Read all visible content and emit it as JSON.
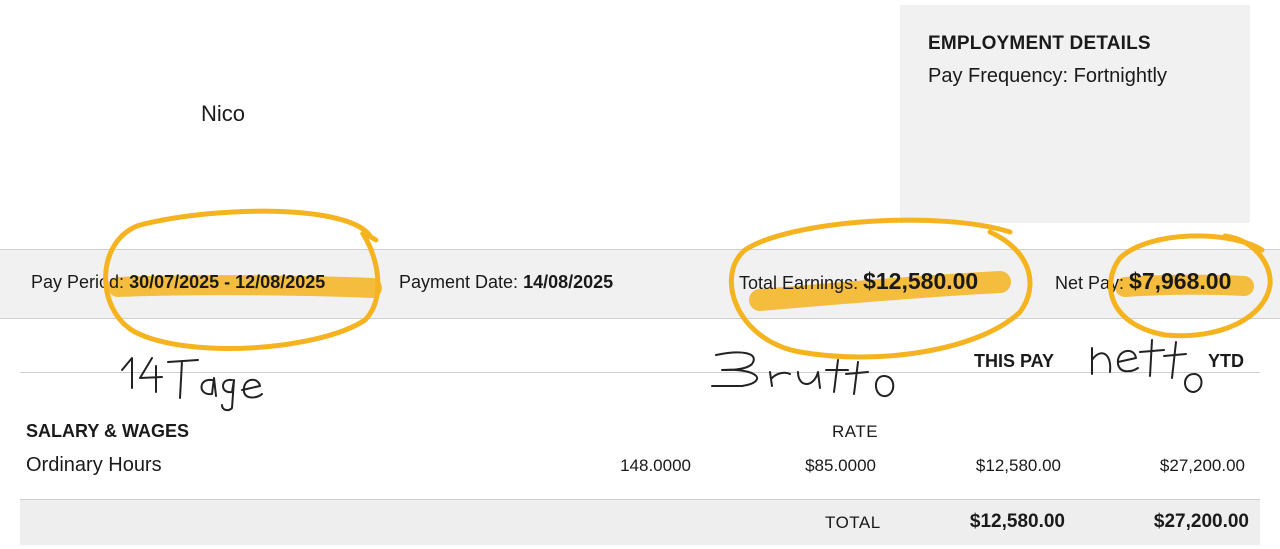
{
  "employee": {
    "name": "Nico"
  },
  "employment_details": {
    "title": "EMPLOYMENT DETAILS",
    "pay_frequency": "Pay Frequency: Fortnightly"
  },
  "summary": {
    "pay_period_label": "Pay Period:",
    "pay_period_value": "30/07/2025 - 12/08/2025",
    "payment_date_label": "Payment Date:",
    "payment_date_value": "14/08/2025",
    "total_earnings_label": "Total Earnings:",
    "total_earnings_value": "$12,580.00",
    "net_pay_label": "Net Pay:",
    "net_pay_value": "$7,968.00"
  },
  "columns": {
    "this_pay": "THIS PAY",
    "ytd": "YTD",
    "rate": "RATE"
  },
  "section": {
    "title": "SALARY & WAGES",
    "rows": [
      {
        "label": "Ordinary Hours",
        "hours": "148.0000",
        "rate": "$85.0000",
        "this_pay": "$12,580.00",
        "ytd": "$27,200.00"
      }
    ]
  },
  "totals": {
    "label": "TOTAL",
    "this_pay": "$12,580.00",
    "ytd": "$27,200.00"
  },
  "annotations": {
    "highlight_color": "#f5b41f",
    "note_days": "14Tage",
    "note_gross": "Brutto",
    "note_net": "netto"
  }
}
